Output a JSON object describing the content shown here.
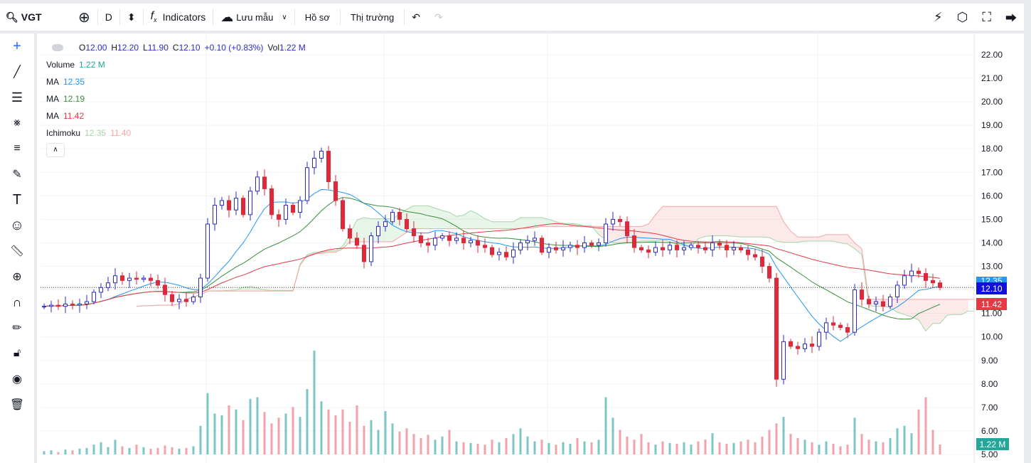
{
  "toolbar": {
    "symbol": "VGT",
    "interval": "D",
    "indicators": "Indicators",
    "save": "Lưu mẫu",
    "profile": "Hồ sơ",
    "market": "Thị trường"
  },
  "legend": {
    "ohlc": {
      "o_label": "O",
      "o": "12.00",
      "h_label": "H",
      "h": "12.20",
      "l_label": "L",
      "l": "11.90",
      "c_label": "C",
      "c": "12.10",
      "change": "+0.10 (+0.83%)",
      "vol_label": "Vol",
      "vol": "1.22 M"
    },
    "volume": {
      "label": "Volume",
      "value": "1.22 M"
    },
    "ma": [
      {
        "label": "MA",
        "value": "12.35",
        "color": "#2196f3"
      },
      {
        "label": "MA",
        "value": "12.19",
        "color": "#388e3c"
      },
      {
        "label": "MA",
        "value": "11.42",
        "color": "#e53945"
      }
    ],
    "ichimoku": {
      "label": "Ichimoku",
      "v1": "12.35",
      "v2": "11.40"
    }
  },
  "price_tags": {
    "ma_fast": "12.35",
    "last": "12.10",
    "ma_slow": "11.42",
    "volume": "1.22 M"
  },
  "chart_data": {
    "type": "candlestick",
    "ylim": [
      5,
      22
    ],
    "yticks": [
      "22.00",
      "21.00",
      "20.00",
      "19.00",
      "18.00",
      "17.00",
      "16.00",
      "15.00",
      "14.00",
      "13.00",
      "12.00",
      "11.00",
      "10.00",
      "9.00",
      "8.00",
      "7.00",
      "6.00",
      "5.00"
    ],
    "ma_periods": [
      10,
      20,
      50
    ],
    "closes": [
      11.3,
      11.35,
      11.3,
      11.4,
      11.35,
      11.4,
      11.5,
      11.9,
      12.1,
      12.3,
      12.6,
      12.4,
      12.5,
      12.45,
      12.5,
      12.4,
      12.2,
      11.8,
      11.5,
      11.6,
      11.5,
      11.7,
      12.5,
      14.8,
      15.6,
      15.8,
      15.4,
      15.9,
      15.2,
      16.2,
      16.8,
      16.3,
      15.2,
      15.0,
      15.6,
      15.3,
      15.8,
      17.2,
      17.6,
      17.9,
      16.6,
      15.8,
      14.6,
      14.2,
      13.9,
      13.2,
      14.3,
      14.7,
      14.9,
      15.3,
      15.0,
      14.6,
      14.3,
      14.0,
      13.9,
      14.2,
      14.3,
      14.1,
      14.2,
      14.0,
      14.1,
      13.9,
      13.8,
      13.5,
      13.6,
      13.4,
      13.7,
      14.0,
      14.1,
      14.2,
      13.6,
      13.8,
      13.7,
      13.8,
      13.9,
      13.8,
      14.0,
      13.9,
      14.0,
      14.8,
      15.0,
      14.9,
      14.3,
      13.8,
      13.7,
      13.6,
      13.8,
      13.7,
      13.9,
      13.7,
      13.8,
      13.9,
      13.8,
      13.7,
      14.0,
      13.9,
      13.7,
      13.8,
      13.7,
      13.5,
      13.4,
      13.0,
      12.5,
      8.2,
      9.8,
      9.6,
      9.5,
      9.7,
      9.6,
      10.2,
      10.6,
      10.5,
      10.4,
      10.2,
      12.0,
      11.6,
      11.4,
      11.5,
      11.3,
      11.7,
      12.2,
      12.6,
      12.8,
      12.7,
      12.4,
      12.3,
      12.1
    ],
    "volumes_m": [
      0.4,
      0.5,
      0.3,
      0.6,
      0.5,
      0.7,
      0.8,
      1.2,
      1.5,
      0.9,
      1.8,
      1.0,
      0.8,
      1.2,
      0.9,
      0.7,
      0.8,
      1.1,
      0.9,
      0.7,
      0.8,
      1.0,
      3.5,
      7.5,
      5.0,
      4.8,
      6.0,
      5.5,
      4.2,
      6.8,
      7.0,
      5.2,
      3.8,
      4.5,
      5.0,
      5.8,
      4.6,
      8.0,
      12.7,
      6.5,
      5.5,
      4.8,
      5.5,
      4.0,
      6.0,
      3.5,
      4.2,
      3.0,
      5.3,
      3.8,
      2.8,
      3.2,
      2.5,
      2.0,
      2.4,
      1.8,
      2.2,
      3.0,
      1.6,
      1.5,
      1.4,
      1.3,
      1.2,
      1.8,
      1.5,
      2.0,
      2.5,
      3.2,
      2.2,
      1.6,
      1.8,
      1.4,
      1.2,
      1.5,
      1.3,
      2.0,
      1.6,
      1.5,
      1.8,
      7.0,
      4.5,
      3.0,
      2.2,
      1.8,
      2.5,
      1.5,
      1.2,
      1.6,
      1.4,
      1.3,
      1.5,
      1.2,
      1.6,
      1.8,
      2.6,
      1.5,
      1.3,
      1.4,
      1.6,
      1.8,
      1.5,
      2.2,
      3.0,
      3.8,
      4.6,
      2.5,
      2.0,
      1.8,
      1.5,
      1.2,
      1.6,
      1.3,
      1.0,
      1.2,
      4.5,
      2.5,
      1.8,
      1.6,
      1.5,
      2.0,
      3.2,
      3.5,
      2.6,
      5.5,
      7.0,
      3.0,
      1.22
    ],
    "colors": {
      "up": "#2a2ad0",
      "down": "#e0283a",
      "vol_up": "#7cc7c4",
      "vol_down": "#f0a3aa",
      "ma1": "#2196f3",
      "ma2": "#388e3c",
      "ma3": "#e53945",
      "cloud_up": "#a5d6a7",
      "cloud_down": "#f4a6a6"
    }
  }
}
